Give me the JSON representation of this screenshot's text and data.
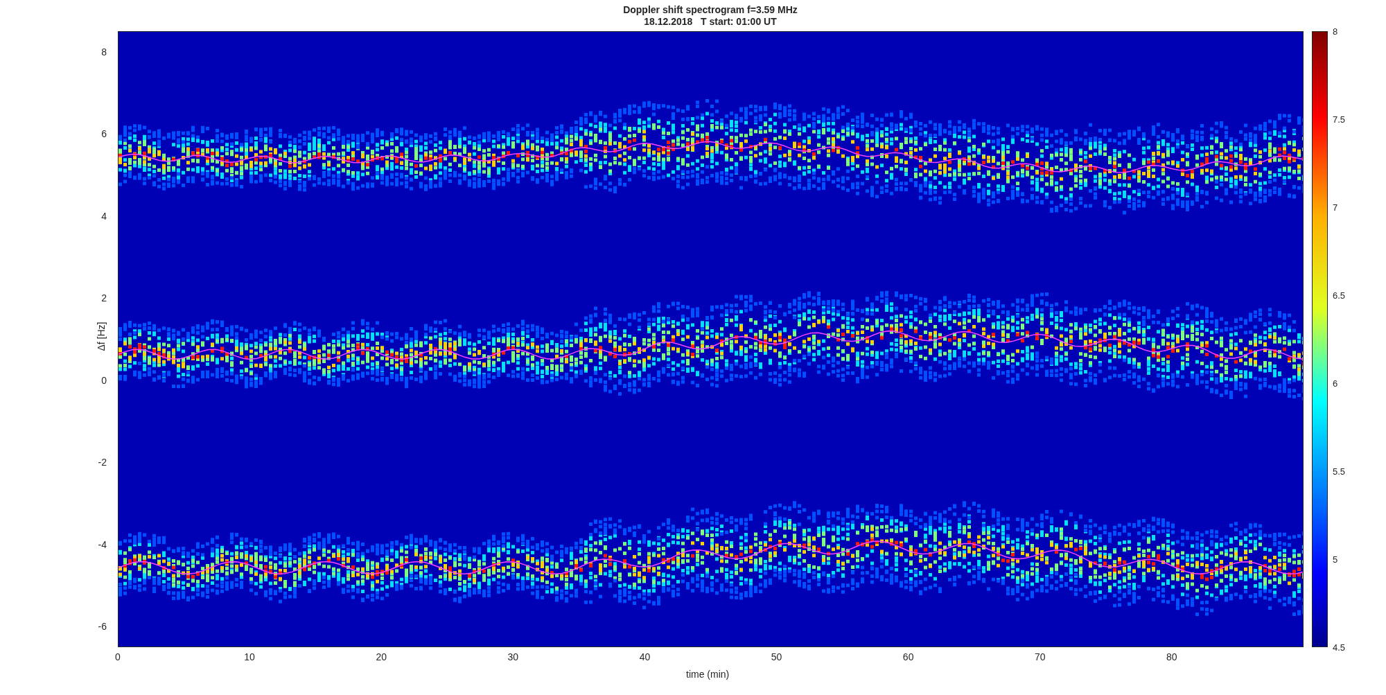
{
  "title": {
    "line_1": "Doppler shift spectrogram f=3.59 MHz",
    "line_2": "18.12.2018   T start: 01:00 UT"
  },
  "x_axis": {
    "label": "time (min)",
    "ticks": [
      "0",
      "10",
      "20",
      "30",
      "40",
      "50",
      "60",
      "70",
      "80"
    ]
  },
  "y_axis": {
    "label": "Δf [Hz]",
    "ticks": [
      "8",
      "6",
      "4",
      "2",
      "0",
      "-2",
      "-4",
      "-6"
    ]
  },
  "colorbar": {
    "ticks": [
      "8",
      "7.5",
      "7",
      "6.5",
      "6",
      "5.5",
      "5",
      "4.5"
    ]
  }
}
